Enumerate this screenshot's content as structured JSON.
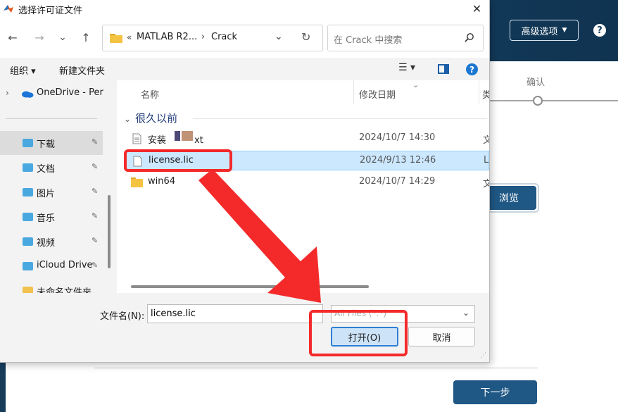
{
  "background_window": {
    "advanced_options_label": "高级选项",
    "help_label": "?",
    "step_label": "确认",
    "browse_label": "浏览",
    "next_label": "下一步"
  },
  "dialog": {
    "title": "选择许可证文件",
    "close_glyph": "✕",
    "nav": {
      "back_glyph": "←",
      "forward_glyph": "→",
      "recent_glyph": "⌄",
      "up_glyph": "↑"
    },
    "address": {
      "prefix": "«",
      "segments": [
        "MATLAB R2...",
        "Crack"
      ],
      "separator": "›",
      "dropdown_glyph": "⌄",
      "refresh_glyph": "↻"
    },
    "search": {
      "placeholder": "在 Crack 中搜索"
    },
    "toolbar": {
      "organize_label": "组织 ▾",
      "new_folder_label": "新建文件夹",
      "view_glyph": "☰ ▾",
      "help_glyph": "?"
    },
    "sidebar": {
      "items": [
        {
          "label": "OneDrive - Per",
          "icon": "onedrive-icon",
          "color": "#1b74d8"
        },
        {
          "label": "下载",
          "icon": "download-folder-icon",
          "color": "#4aa8e0"
        },
        {
          "label": "文档",
          "icon": "documents-folder-icon",
          "color": "#4aa8e0"
        },
        {
          "label": "图片",
          "icon": "pictures-folder-icon",
          "color": "#4aa8e0"
        },
        {
          "label": "音乐",
          "icon": "music-folder-icon",
          "color": "#4aa8e0"
        },
        {
          "label": "视频",
          "icon": "videos-folder-icon",
          "color": "#4aa8e0"
        },
        {
          "label": "iCloud Drive",
          "icon": "icloud-folder-icon",
          "color": "#4aa8e0"
        },
        {
          "label": "未命名文件夹",
          "icon": "folder-icon",
          "color": "#f2c14e"
        }
      ],
      "chevron_glyph": "›",
      "pin_glyph": "📌"
    },
    "file_list": {
      "columns": [
        "名称",
        "修改日期",
        "类"
      ],
      "group_label": "很久以前",
      "group_chevron": "⌄",
      "files": [
        {
          "name_start": "安装",
          "name_end": "xt",
          "date": "2024/10/7 14:30",
          "type": "文",
          "icon": "text-file-icon"
        },
        {
          "name": "license.lic",
          "date": "2024/9/13 12:46",
          "type": "LI",
          "icon": "file-icon",
          "selected": true
        },
        {
          "name": "win64",
          "date": "2024/10/7 14:29",
          "type": "文",
          "icon": "folder-icon"
        }
      ]
    },
    "bottom": {
      "filename_label": "文件名(N):",
      "filename_value": "license.lic",
      "filetype_value": "All Files (*.*)",
      "open_label": "打开(O)",
      "cancel_label": "取消"
    }
  },
  "colors": {
    "header_bg": "#1b4a70",
    "accent": "#1f5785",
    "selection": "#cce8ff",
    "annotation_red": "#f42a2a"
  }
}
